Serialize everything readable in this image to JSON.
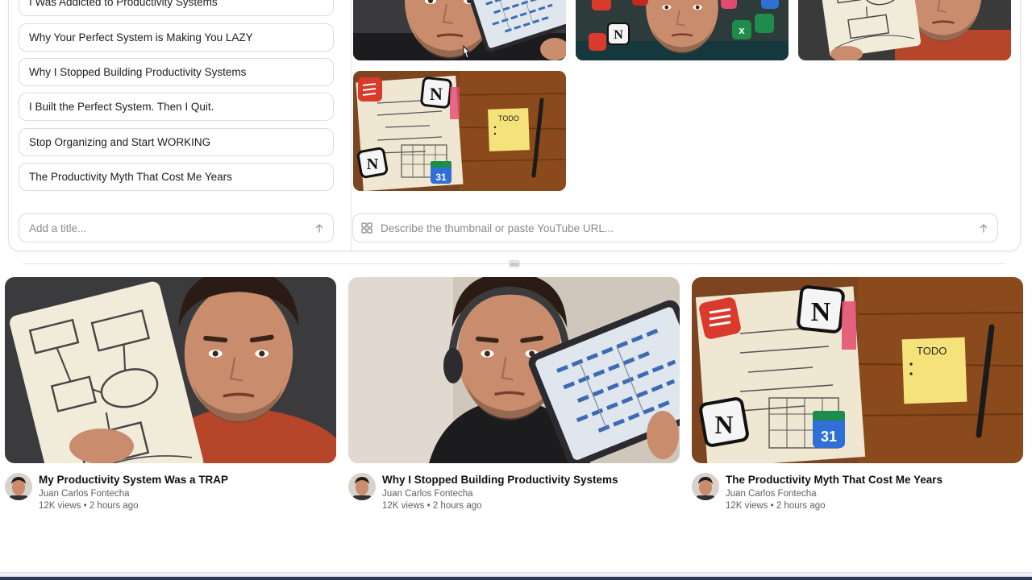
{
  "titles": {
    "items": [
      "I Was Addicted to Productivity Systems",
      "Why Your Perfect System is Making You LAZY",
      "Why I Stopped Building Productivity Systems",
      "I Built the Perfect System. Then I Quit.",
      "Stop Organizing and Start WORKING",
      "The Productivity Myth That Cost Me Years"
    ],
    "input_placeholder": "Add a title..."
  },
  "thumbnails": {
    "todo_label": "TODO",
    "calendar_number": "31",
    "input_placeholder": "Describe the thumbnail or paste YouTube URL..."
  },
  "previews": [
    {
      "title": "My Productivity System Was a TRAP",
      "channel": "Juan Carlos Fontecha",
      "stats": "12K views • 2 hours ago"
    },
    {
      "title": "Why I Stopped Building Productivity Systems",
      "channel": "Juan Carlos Fontecha",
      "stats": "12K views • 2 hours ago"
    },
    {
      "title": "The Productivity Myth That Cost Me Years",
      "channel": "Juan Carlos Fontecha",
      "stats": "12K views • 2 hours ago"
    }
  ],
  "colors": {
    "accent_red": "#d93a2b",
    "sticky_note": "#f6e27a",
    "wood": "#8a4a1c",
    "sweater_red": "#b5462a"
  }
}
